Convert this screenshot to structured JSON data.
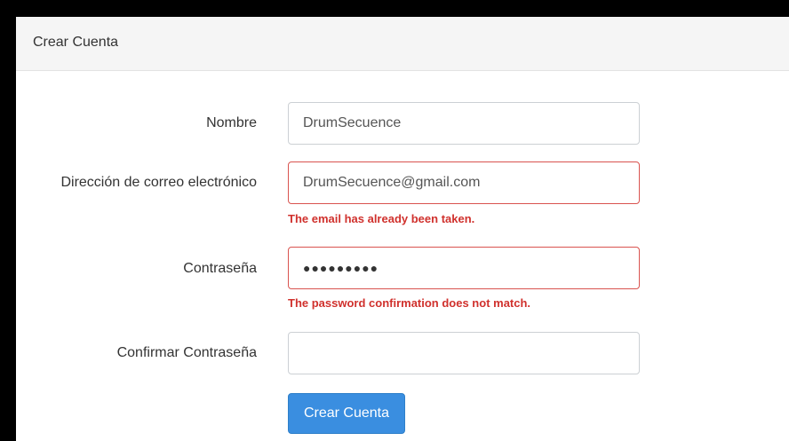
{
  "card": {
    "title": "Crear Cuenta"
  },
  "form": {
    "name": {
      "label": "Nombre",
      "value": "DrumSecuence"
    },
    "email": {
      "label": "Dirección de correo electrónico",
      "value": "DrumSecuence@gmail.com",
      "error": "The email has already been taken."
    },
    "password": {
      "label": "Contraseña",
      "masked_value": "●●●●●●●●●",
      "error": "The password confirmation does not match."
    },
    "password_confirm": {
      "label": "Confirmar Contraseña",
      "value": ""
    },
    "submit_label": "Crear Cuenta"
  },
  "colors": {
    "error": "#d0312d",
    "primary": "#3a8ee0",
    "header_bg": "#f5f5f5"
  }
}
